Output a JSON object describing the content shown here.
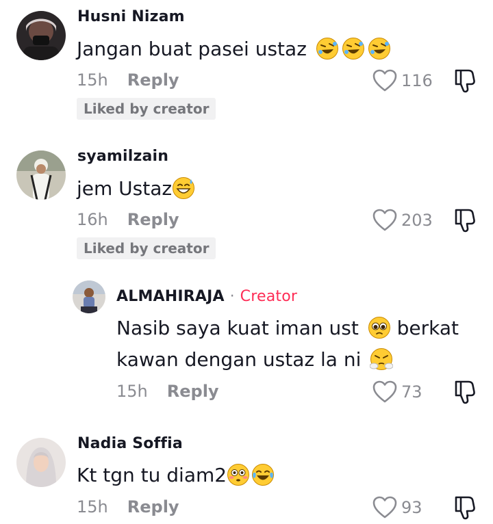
{
  "comments": [
    {
      "username": "Husni Nizam",
      "text": "Jangan buat pasei ustaz",
      "emojis": [
        "rofl-emoji",
        "rofl-emoji",
        "rofl-emoji"
      ],
      "time": "15h",
      "reply_label": "Reply",
      "likes": "116",
      "badge": "Liked by creator"
    },
    {
      "username": "syamilzain",
      "text": "jem Ustaz",
      "emojis": [
        "grinning-sweat-emoji"
      ],
      "time": "16h",
      "reply_label": "Reply",
      "likes": "203",
      "badge": "Liked by creator"
    },
    {
      "username": "ALMAHIRAJA",
      "separator": "·",
      "creator_label": "Creator",
      "text_line1": "Nasib saya kuat iman ust",
      "text_line1_after": "berkat",
      "text_line2": "kawan dengan ustaz la ni",
      "emojis": [
        "pleading-face-emoji",
        "steam-from-nose-emoji"
      ],
      "time": "15h",
      "reply_label": "Reply",
      "likes": "73"
    },
    {
      "username": "Nadia Soffia",
      "text": "Kt tgn tu diam2",
      "emojis": [
        "flushed-face-emoji",
        "crying-laughing-emoji"
      ],
      "time": "15h",
      "reply_label": "Reply",
      "likes": "93"
    }
  ],
  "colors": {
    "text": "#161823",
    "muted": "#8a8b91",
    "creator": "#fe2c55",
    "badge_bg": "#f1f1f2"
  }
}
